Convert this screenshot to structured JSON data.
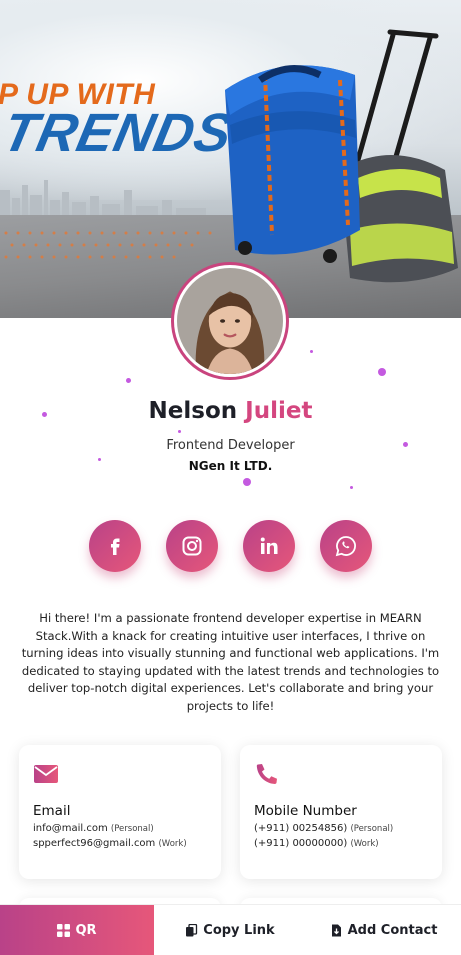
{
  "banner": {
    "headline_line1": "P UP WITH",
    "headline_line2": "TRENDS"
  },
  "profile": {
    "first_name": "Nelson",
    "last_name": "Juliet",
    "role": "Frontend Developer",
    "company": "NGen It LTD."
  },
  "socials": [
    {
      "name": "facebook",
      "icon": "facebook-icon"
    },
    {
      "name": "instagram",
      "icon": "instagram-icon"
    },
    {
      "name": "linkedin",
      "icon": "linkedin-icon"
    },
    {
      "name": "whatsapp",
      "icon": "whatsapp-icon"
    }
  ],
  "bio": "Hi there! I'm a passionate frontend developer expertise in MEARN Stack.With a knack for creating intuitive user interfaces, I thrive on turning ideas into visually stunning and functional web applications. I'm dedicated to staying updated with the latest trends and technologies to deliver top-notch digital experiences. Let's collaborate and bring your projects to life!",
  "contact_cards": {
    "email": {
      "title": "Email",
      "icon": "mail-icon",
      "entries": [
        {
          "value": "info@mail.com",
          "tag": "(Personal)"
        },
        {
          "value": "spperfect96@gmail.com",
          "tag": "(Work)"
        }
      ]
    },
    "phone": {
      "title": "Mobile Number",
      "icon": "phone-icon",
      "entries": [
        {
          "value": "(+911) 00254856)",
          "tag": "(Personal)"
        },
        {
          "value": "(+911) 00000000)",
          "tag": "(Work)"
        }
      ]
    }
  },
  "bottom_bar": {
    "qr_label": "QR",
    "copy_label": "Copy Link",
    "add_label": "Add Contact"
  },
  "colors": {
    "accent_start": "#b94288",
    "accent_end": "#e6577a",
    "name_accent": "#d4467f",
    "headline_orange": "#e46a1c",
    "headline_blue": "#1d68b5"
  }
}
